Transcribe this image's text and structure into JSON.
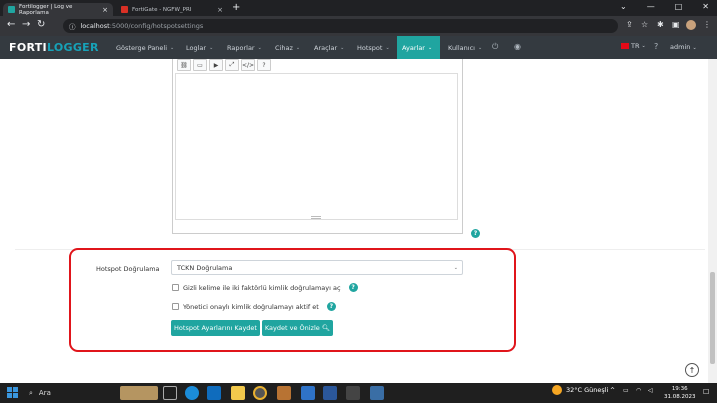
{
  "browser": {
    "tabs": [
      {
        "title": "Fortilogger | Log ve Raporlama",
        "favicon": "FL"
      },
      {
        "title": "FortiGate - NGFW_PRI",
        "favicon": "FG"
      }
    ],
    "new_tab": "+",
    "url_host": "localhost",
    "url_path": ":5000/config/hotspotsettings"
  },
  "app": {
    "logo_main": "FORTI",
    "logo_accent": "LOGGER",
    "menu": [
      {
        "label": "Gösterge Paneli",
        "caret": true
      },
      {
        "label": "Loglar",
        "caret": true
      },
      {
        "label": "Raporlar",
        "caret": true
      },
      {
        "label": "Cihaz",
        "caret": true
      },
      {
        "label": "Araçlar",
        "caret": true
      },
      {
        "label": "Hotspot",
        "caret": true
      },
      {
        "label": "Ayarlar",
        "caret": true
      },
      {
        "label": "Kullanıcı",
        "caret": true
      }
    ],
    "lang": "TR",
    "user": "admin"
  },
  "editor_toolbar": [
    "link-icon",
    "image-icon",
    "video-icon",
    "fullscreen-icon",
    "code-icon",
    "help-icon"
  ],
  "form": {
    "auth_label": "Hotspot Doğrulama",
    "auth_value": "TCKN Doğrulama",
    "checkbox1": "Gizli kelime ile iki faktörlü kimlik doğrulamayı aç",
    "checkbox2": "Yönetici onaylı kimlik doğrulamayı aktif et",
    "save_button": "Hotspot Ayarlarını Kaydet",
    "save_preview_button": "Kaydet ve Önizle"
  },
  "taskbar": {
    "search_placeholder": "Ara",
    "weather": "32°C  Güneşli",
    "time": "19:36",
    "date": "31.08.2023"
  },
  "colors": {
    "accent": "#20a5a0",
    "highlight": "#e0151b",
    "navbar": "#343a40"
  }
}
